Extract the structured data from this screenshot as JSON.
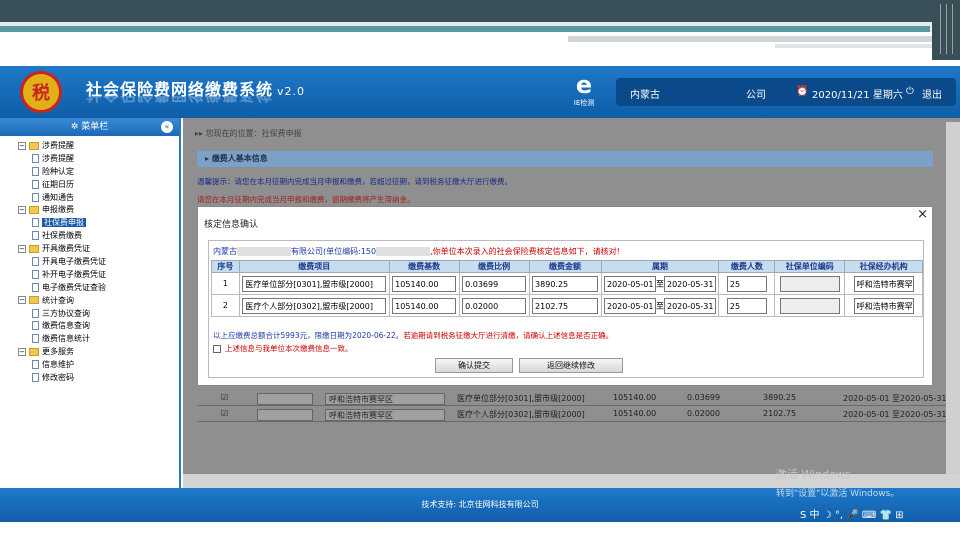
{
  "header": {
    "title": "社会保险费网络缴费系统",
    "version": "v2.0",
    "ie_check": "IE检测",
    "region": "内蒙古",
    "company": "公司",
    "datetime": "2020/11/21 星期六",
    "logout": "退出"
  },
  "sidebar": {
    "title": "菜单栏",
    "groups": [
      {
        "label": "涉费提醒",
        "items": [
          "涉费提醒",
          "险种认定",
          "征期日历",
          "通知通告"
        ]
      },
      {
        "label": "申报缴费",
        "items": [
          "社保费申报",
          "社保费缴费"
        ],
        "selected": "社保费申报"
      },
      {
        "label": "开具缴费凭证",
        "items": [
          "开具电子缴费凭证",
          "补开电子缴费凭证",
          "电子缴费凭证查验"
        ]
      },
      {
        "label": "统计查询",
        "items": [
          "三方协议查询",
          "缴费信息查询",
          "缴费信息统计"
        ]
      },
      {
        "label": "更多服务",
        "items": [
          "信息维护",
          "修改密码"
        ]
      }
    ]
  },
  "main": {
    "breadcrumb": "您现在的位置：社保费申报",
    "panel_title": "缴费人基本信息",
    "warn1": "温馨提示：请您在本月征期内完成当月申报和缴费，若超过征期，请到税务征缴大厅进行缴费。",
    "warn2": "请您在本月征期内完成当月申报和缴费，逾期缴费将产生滞纳金。",
    "bg_rows": [
      {
        "region": "呼和浩特市赛罕区",
        "item": "医疗单位部分[0301],盟市级[2000]",
        "base": "105140.00",
        "ratio": "0.03699",
        "amount": "3890.25",
        "period": "2020-05-01 至2020-05-31"
      },
      {
        "region": "呼和浩特市赛罕区",
        "item": "医疗个人部分[0302],盟市级[2000]",
        "base": "105140.00",
        "ratio": "0.02000",
        "amount": "2102.75",
        "period": "2020-05-01 至2020-05-31"
      }
    ]
  },
  "modal": {
    "title": "核定信息确认",
    "close": "×",
    "info_prefix": "内蒙古",
    "info_mid": "有限公司(单位编码:150",
    "info_suffix": ",你单位本次录入的社会保险费核定信息如下，请核对!",
    "headers": [
      "序号",
      "缴费项目",
      "缴费基数",
      "缴费比例",
      "缴费金额",
      "属期",
      "缴费人数",
      "社保单位编码",
      "社保经办机构"
    ],
    "rows": [
      {
        "no": "1",
        "item": "医疗单位部分[0301],盟市级[2000]",
        "base": "105140.00",
        "ratio": "0.03699",
        "amount": "3890.25",
        "start": "2020-05-01",
        "sep": "至",
        "end": "2020-05-31",
        "count": "25",
        "agency": "呼和浩特市赛罕"
      },
      {
        "no": "2",
        "item": "医疗个人部分[0302],盟市级[2000]",
        "base": "105140.00",
        "ratio": "0.02000",
        "amount": "2102.75",
        "start": "2020-05-01",
        "sep": "至",
        "end": "2020-05-31",
        "count": "25",
        "agency": "呼和浩特市赛罕"
      }
    ],
    "note_a": "以上应缴费总额合计5993元，限缴日期为2020-06-22。",
    "note_b": "若逾期请到税务征缴大厅进行清缴，请确认上述信息是否正确。",
    "agree": "上述信息与我单位本次缴费信息一致。",
    "confirm_btn": "确认提交",
    "back_btn": "返回继续修改"
  },
  "footer": {
    "support": "技术支持: 北京佳网科技有限公司"
  },
  "watermark": {
    "line1": "激活 Windows",
    "line2": "转到\"设置\"以激活 Windows。"
  }
}
